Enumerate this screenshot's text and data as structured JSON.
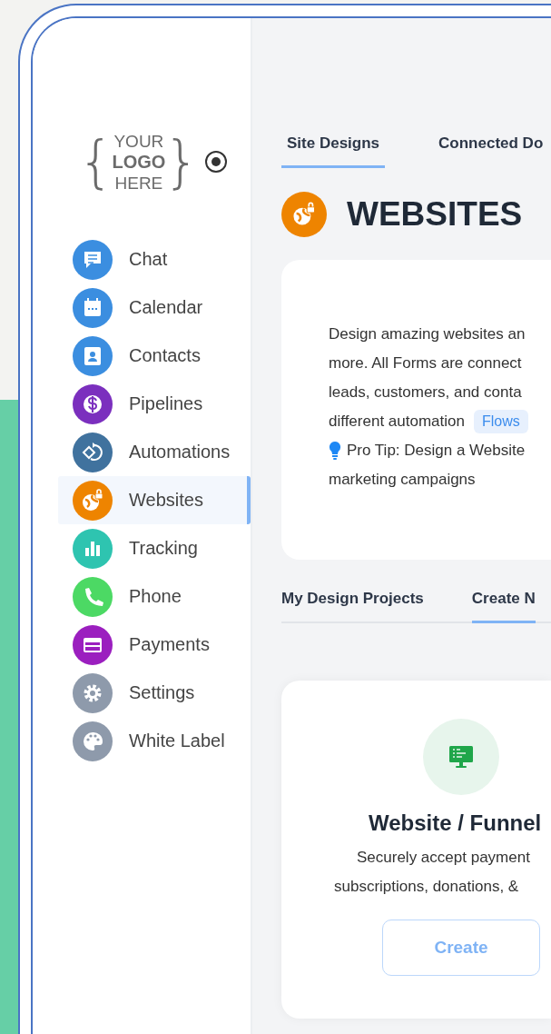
{
  "logo": {
    "braces": [
      "{",
      "}"
    ],
    "lines": [
      "YOUR",
      "LOGO",
      "HERE"
    ]
  },
  "sidebar": {
    "items": [
      {
        "label": "Chat",
        "kind": "chat",
        "color": "#3b8ee0",
        "selected": false
      },
      {
        "label": "Calendar",
        "kind": "calendar",
        "color": "#3b8ee0",
        "selected": false
      },
      {
        "label": "Contacts",
        "kind": "contacts",
        "color": "#3b8ee0",
        "selected": false
      },
      {
        "label": "Pipelines",
        "kind": "dollar",
        "color": "#7b2fbe",
        "selected": false
      },
      {
        "label": "Automations",
        "kind": "automation",
        "color": "#40729e",
        "selected": false
      },
      {
        "label": "Websites",
        "kind": "globe",
        "color": "#ee8400",
        "selected": true
      },
      {
        "label": "Tracking",
        "kind": "chart",
        "color": "#2ec4b0",
        "selected": false
      },
      {
        "label": "Phone",
        "kind": "phone",
        "color": "#4cd964",
        "selected": false
      },
      {
        "label": "Payments",
        "kind": "card",
        "color": "#9b1fbf",
        "selected": false
      },
      {
        "label": "Settings",
        "kind": "gear",
        "color": "#8e9aab",
        "selected": false
      },
      {
        "label": "White Label",
        "kind": "palette",
        "color": "#8e9aab",
        "selected": false
      }
    ]
  },
  "tabs": [
    {
      "label": "Site Designs",
      "selected": true
    },
    {
      "label": "Connected Do",
      "selected": false
    }
  ],
  "header": {
    "title": "WEBSITES"
  },
  "intro": {
    "lines": [
      {
        "kind": "text",
        "text": "Design amazing websites an"
      },
      {
        "kind": "text",
        "text": "more. All Forms are connect"
      },
      {
        "kind": "text",
        "text": "leads, customers, and conta"
      },
      {
        "kind": "text",
        "text": "different automation",
        "badge": "Flows"
      },
      {
        "kind": "tip",
        "text": "Pro Tip: Design a Website"
      },
      {
        "kind": "text",
        "text": "marketing campaigns"
      }
    ]
  },
  "project_tabs": [
    {
      "label": "My Design Projects",
      "selected": false
    },
    {
      "label": "Create N",
      "selected": true
    }
  ],
  "template_card": {
    "title": "Website / Funnel",
    "description": [
      "Securely accept payment",
      "subscriptions, donations, &"
    ],
    "button": "Create"
  }
}
